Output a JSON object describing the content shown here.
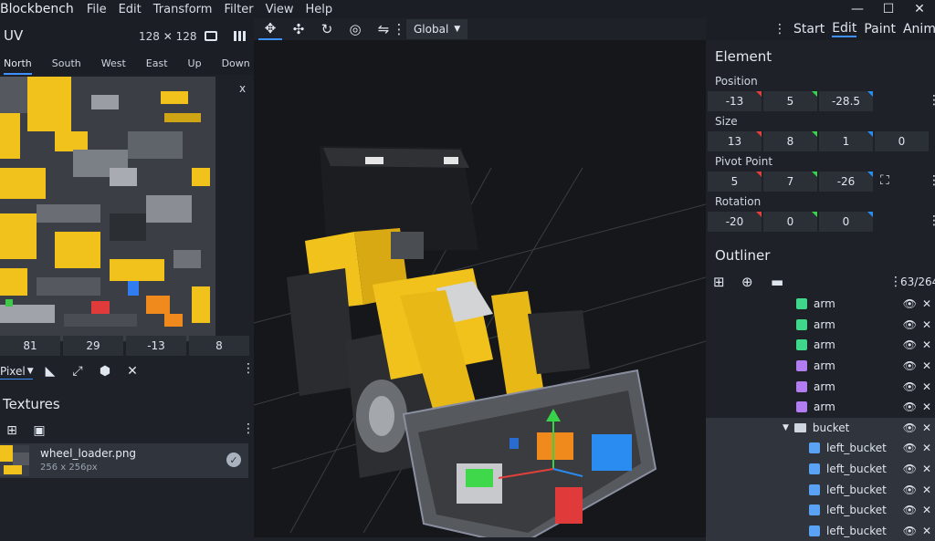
{
  "app": {
    "title": "Blockbench"
  },
  "menu": [
    "File",
    "Edit",
    "Transform",
    "Filter",
    "View",
    "Help"
  ],
  "window_controls": {
    "minimize": "—",
    "maximize": "☐",
    "close": "✕"
  },
  "uv": {
    "title": "UV",
    "size": "128 ✕ 128",
    "tabs": [
      "North",
      "South",
      "West",
      "East",
      "Up",
      "Down"
    ],
    "active_tab": "North",
    "close": "x",
    "inputs": [
      "81",
      "29",
      "-13",
      "8"
    ],
    "mode": "Pixel"
  },
  "textures": {
    "title": "Textures",
    "items": [
      {
        "name": "wheel_loader.png",
        "size": "256 x 256px"
      }
    ]
  },
  "viewport": {
    "space": "Global"
  },
  "modes": {
    "tabs": [
      "Start",
      "Edit",
      "Paint",
      "Animate"
    ],
    "active": "Edit"
  },
  "element": {
    "title": "Element",
    "position": {
      "label": "Position",
      "values": [
        "-13",
        "5",
        "-28.5"
      ]
    },
    "size": {
      "label": "Size",
      "values": [
        "13",
        "8",
        "1",
        "0"
      ]
    },
    "pivot": {
      "label": "Pivot Point",
      "values": [
        "5",
        "7",
        "-26"
      ]
    },
    "rotation": {
      "label": "Rotation",
      "values": [
        "-20",
        "0",
        "0"
      ]
    }
  },
  "outliner": {
    "title": "Outliner",
    "count": "63/264",
    "rows": [
      {
        "name": "arm",
        "color": "#3fd88a",
        "indent": 1
      },
      {
        "name": "arm",
        "color": "#3fd88a",
        "indent": 1
      },
      {
        "name": "arm",
        "color": "#3fd88a",
        "indent": 1
      },
      {
        "name": "arm",
        "color": "#b17df0",
        "indent": 1
      },
      {
        "name": "arm",
        "color": "#b17df0",
        "indent": 1
      },
      {
        "name": "arm",
        "color": "#b17df0",
        "indent": 1
      },
      {
        "name": "bucket",
        "color": "#cfd6e0",
        "indent": 0,
        "folder": true
      },
      {
        "name": "left_bucket",
        "color": "#5aa2f5",
        "indent": 2
      },
      {
        "name": "left_bucket",
        "color": "#5aa2f5",
        "indent": 2
      },
      {
        "name": "left_bucket",
        "color": "#5aa2f5",
        "indent": 2
      },
      {
        "name": "left_bucket",
        "color": "#5aa2f5",
        "indent": 2
      },
      {
        "name": "left_bucket",
        "color": "#5aa2f5",
        "indent": 2
      }
    ]
  },
  "colors": {
    "accent": "#3e90ff",
    "panel": "#1e2127",
    "viewport": "#15171b",
    "yellow": "#f2c21c"
  }
}
